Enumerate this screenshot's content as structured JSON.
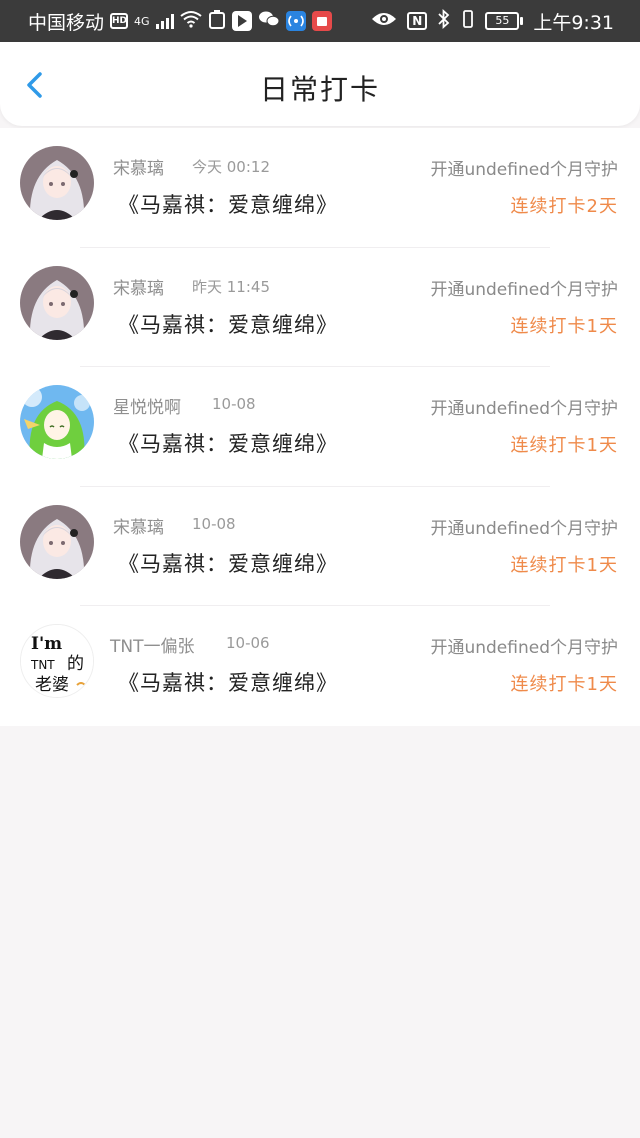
{
  "status_bar": {
    "carrier": "中国移动",
    "hd": "HD",
    "network": "4G",
    "nfc": "N",
    "battery": "55",
    "time": "上午9:31"
  },
  "header": {
    "title": "日常打卡",
    "back_icon": "chevron-left-icon"
  },
  "checkins": [
    {
      "name": "宋慕璃",
      "time": "今天 00:12",
      "guard": "开通undefined个月守护",
      "song": "《马嘉祺：爱意缠绵》",
      "streak": "连续打卡2天",
      "avatar": "anime-girl-silver-hair"
    },
    {
      "name": "宋慕璃",
      "time": "昨天 11:45",
      "guard": "开通undefined个月守护",
      "song": "《马嘉祺：爱意缠绵》",
      "streak": "连续打卡1天",
      "avatar": "anime-girl-silver-hair"
    },
    {
      "name": "星悦悦啊",
      "time": "10-08",
      "guard": "开通undefined个月守护",
      "song": "《马嘉祺：爱意缠绵》",
      "streak": "连续打卡1天",
      "avatar": "anime-girl-green-hair"
    },
    {
      "name": "宋慕璃",
      "time": "10-08",
      "guard": "开通undefined个月守护",
      "song": "《马嘉祺：爱意缠绵》",
      "streak": "连续打卡1天",
      "avatar": "anime-girl-silver-hair"
    },
    {
      "name": "TNT一偏张",
      "time": "10-06",
      "guard": "开通undefined个月守护",
      "song": "《马嘉祺：爱意缠绵》",
      "streak": "连续打卡1天",
      "avatar": "text-avatar",
      "avatar_text": {
        "line1": "I'm",
        "line2": "TNT",
        "line3": "的",
        "line4": "老婆"
      }
    }
  ],
  "colors": {
    "streak": "#ef8a4a",
    "back_arrow": "#2f9ae8",
    "status_bar": "#3b3b3b"
  }
}
